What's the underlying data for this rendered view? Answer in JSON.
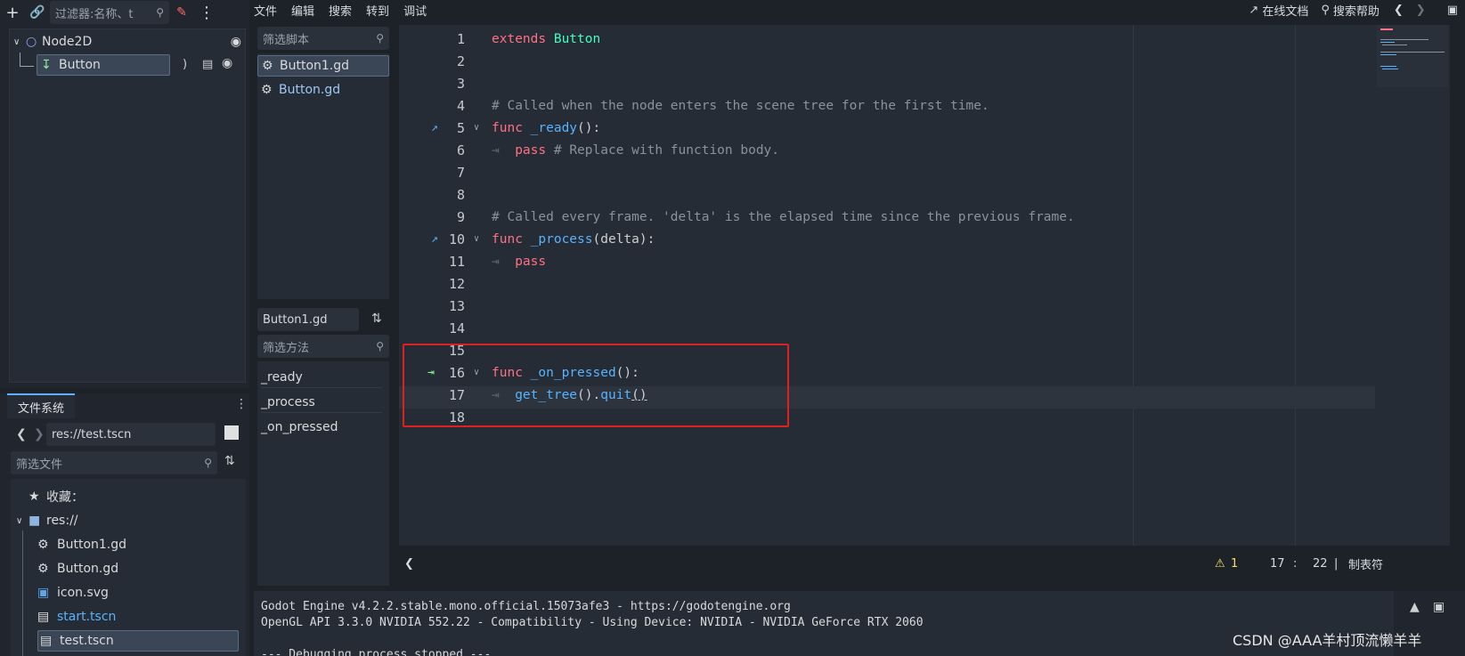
{
  "scene_dock": {
    "filter_placeholder": "过滤器:名称、t",
    "tree": [
      {
        "label": "Node2D"
      },
      {
        "label": "Button"
      }
    ]
  },
  "filesystem": {
    "tab": "文件系统",
    "path": "res://test.tscn",
    "filter_placeholder": "筛选文件",
    "favorites": "收藏：",
    "root": "res://",
    "files": [
      {
        "label": "Button1.gd",
        "icon": "gear-icon"
      },
      {
        "label": "Button.gd",
        "icon": "gear-icon"
      },
      {
        "label": "icon.svg",
        "icon": "image-icon"
      },
      {
        "label": "start.tscn",
        "icon": "scene-icon"
      },
      {
        "label": "test.tscn",
        "icon": "scene-icon"
      }
    ]
  },
  "menu": {
    "items": [
      "文件",
      "编辑",
      "搜索",
      "转到",
      "调试"
    ],
    "online_docs": "在线文档",
    "search_help": "搜索帮助"
  },
  "scripts": {
    "filter_placeholder": "筛选脚本",
    "items": [
      "Button1.gd",
      "Button.gd"
    ],
    "current": "Button1.gd",
    "method_filter_placeholder": "筛选方法",
    "methods": [
      "_ready",
      "_process",
      "_on_pressed"
    ]
  },
  "editor": {
    "line_numbers": [
      "1",
      "2",
      "3",
      "4",
      "5",
      "6",
      "7",
      "8",
      "9",
      "10",
      "11",
      "12",
      "13",
      "14",
      "15",
      "16",
      "17",
      "18"
    ],
    "line1": {
      "kw": "extends",
      "ty": "Button"
    },
    "line4": "# Called when the node enters the scene tree for the first time.",
    "line5": {
      "kw": "func",
      "fn": "_ready",
      "rest": "():"
    },
    "line6": {
      "kw": "pass",
      "cm": "# Replace with function body."
    },
    "line9": "# Called every frame. 'delta' is the elapsed time since the previous frame.",
    "line10": {
      "kw": "func",
      "fn": "_process",
      "rest": "(delta):"
    },
    "line11": {
      "kw": "pass"
    },
    "line16": {
      "kw": "func",
      "fn": "_on_pressed",
      "rest": "():"
    },
    "line17": {
      "fn1": "get_tree",
      "p1": "().",
      "fn2": "quit",
      "p2": "()"
    }
  },
  "status": {
    "warnings": "1",
    "line": "17",
    "col": "22",
    "indent": "制表符"
  },
  "output": {
    "lines": [
      "Godot Engine v4.2.2.stable.mono.official.15073afe3 - https://godotengine.org",
      "OpenGL API 3.3.0 NVIDIA 552.22 - Compatibility - Using Device: NVIDIA - NVIDIA GeForce RTX 2060",
      "",
      "--- Debugging process stopped ---"
    ]
  },
  "watermark": "CSDN @AAA羊村顶流懒羊羊",
  "colors": {
    "keyword": "#ff7085",
    "type": "#42ffc2",
    "function": "#57b3ff",
    "comment": "#8a929c",
    "highlight_box": "#e02020"
  }
}
